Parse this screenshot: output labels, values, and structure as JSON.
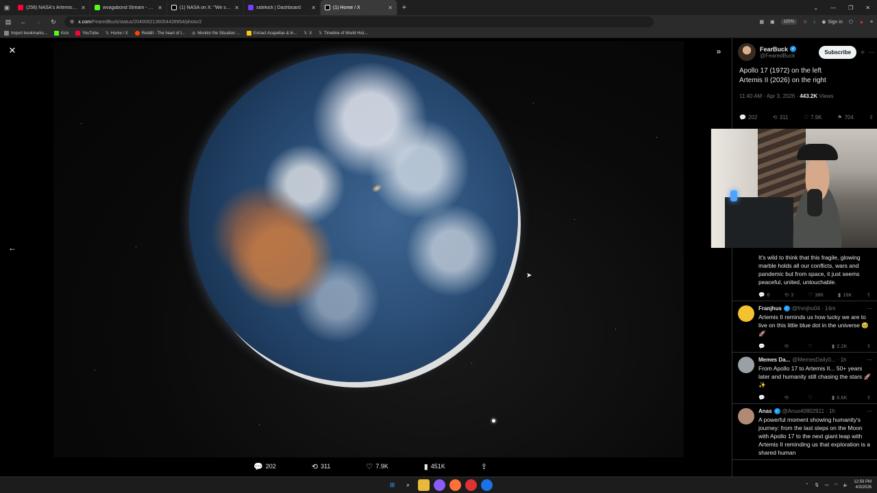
{
  "browser": {
    "tabs": [
      {
        "label": "(258) NASA's Artemis II Live Mi",
        "color": "#ff0033"
      },
      {
        "label": "wvagabond Stream - Watch Liv",
        "color": "#53fc18"
      },
      {
        "label": "(1) NASA on X: \"We see our ho",
        "color": "#ffffff"
      },
      {
        "label": "sidekick | Dashboard",
        "color": "#7a3cff"
      },
      {
        "label": "(1) Home / X",
        "color": "#ffffff"
      }
    ],
    "url_host": "x.com",
    "url_path": "/FearedBuck/status/2040092136054439954/photo/2",
    "zoom": "120%",
    "signin": "Sign in",
    "bookmarks": [
      "Import bookmarks...",
      "Kick",
      "YouTube",
      "Home / X",
      "Reddit - The heart of t...",
      "Monitor the Situation ...",
      "Extract Acapellas & In...",
      "X",
      "Timeline of World Hist..."
    ]
  },
  "viewer": {
    "actions": {
      "replies": "202",
      "reposts": "311",
      "likes": "7.9K",
      "views": "451K"
    }
  },
  "post": {
    "display_name": "FearBuck",
    "handle": "@FearedBuck",
    "subscribe": "Subscribe",
    "text_line1": "Apollo 17 (1972) on the left",
    "text_line2": "Artemis II (2026) on the right",
    "time": "11:40 AM · Apr 3, 2026 ·",
    "views": "443.2K",
    "views_label": "Views",
    "stats": {
      "replies": "202",
      "reposts": "311",
      "likes": "7.9K",
      "bookmarks": "704"
    }
  },
  "replies": [
    {
      "name": "",
      "handle": "",
      "text": "It's wild to think that this fragile, glowing marble holds all our conflicts, wars and pandemic but from space, it just seems peaceful, united, untouchable.",
      "replies": "6",
      "reposts": "3",
      "likes": "386",
      "views": "16K"
    },
    {
      "name": "Franjhus",
      "handle": "@frvnjho04 · 14m",
      "text": "Artemis II reminds us how lucky we are to live on this little blue dot in the universe 🥹🚀",
      "replies": "",
      "reposts": "",
      "likes": "",
      "views": "2.2K"
    },
    {
      "name": "Memes Da...",
      "handle": "@MemesDaily0... · 1h",
      "text": "From Apollo 17 to Artemis II... 50+ years later and humanity still chasing the stars 🚀✨",
      "replies": "",
      "reposts": "",
      "likes": "",
      "views": "6.6K"
    },
    {
      "name": "Anas",
      "handle": "@Anus40802911 · 1h",
      "text": "A powerful moment showing humanity's journey: from the last steps on the Moon with Apollo 17 to the next giant leap with Artemis II reminding us that exploration is a shared human",
      "replies": "",
      "reposts": "",
      "likes": "",
      "views": ""
    }
  ],
  "taskbar": {
    "time": "12:59 PM",
    "date": "4/3/2026"
  }
}
